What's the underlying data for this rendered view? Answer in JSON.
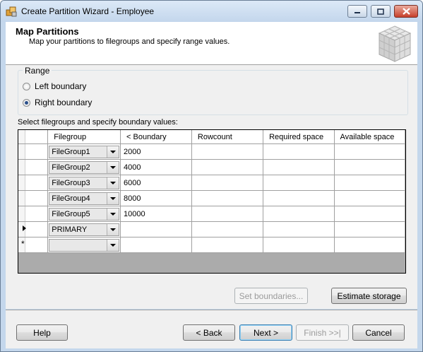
{
  "window": {
    "title": "Create Partition Wizard - Employee"
  },
  "header": {
    "title": "Map Partitions",
    "subtitle": "Map your partitions to filegroups and specify range values."
  },
  "range": {
    "legend": "Range",
    "options": [
      {
        "label": "Left boundary",
        "selected": false
      },
      {
        "label": "Right boundary",
        "selected": true
      }
    ]
  },
  "grid": {
    "label": "Select filegroups and specify boundary values:",
    "columns": [
      "Filegroup",
      "< Boundary",
      "Rowcount",
      "Required space",
      "Available space"
    ],
    "rows": [
      {
        "filegroup": "FileGroup1",
        "boundary": "2000"
      },
      {
        "filegroup": "FileGroup2",
        "boundary": "4000"
      },
      {
        "filegroup": "FileGroup3",
        "boundary": "6000"
      },
      {
        "filegroup": "FileGroup4",
        "boundary": "8000"
      },
      {
        "filegroup": "FileGroup5",
        "boundary": "10000"
      },
      {
        "filegroup": "PRIMARY",
        "boundary": ""
      },
      {
        "filegroup": "",
        "boundary": ""
      }
    ],
    "new_row_marker": "*"
  },
  "actions": {
    "set_boundaries": "Set boundaries...",
    "estimate_storage": "Estimate storage"
  },
  "footer": {
    "help": "Help",
    "back": "< Back",
    "next": "Next >",
    "finish": "Finish >>|",
    "cancel": "Cancel"
  },
  "colors": {
    "title_bar": "#c3d6ec",
    "panel": "#f0f0f0",
    "default_button_border": "#3c7fb1"
  }
}
